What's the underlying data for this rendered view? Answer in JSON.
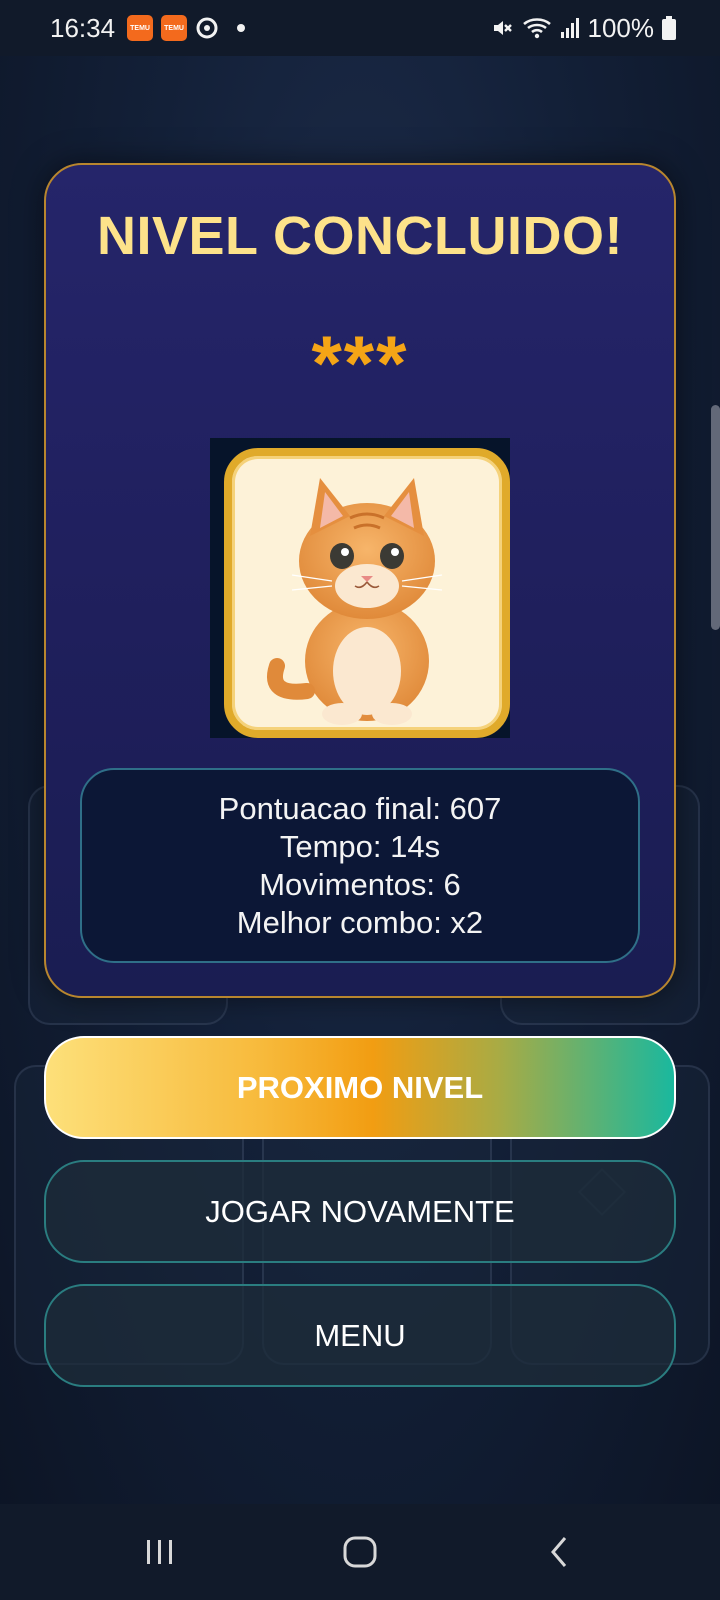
{
  "status_bar": {
    "time": "16:34",
    "battery": "100%",
    "notification_apps": [
      "Temu",
      "Temu"
    ]
  },
  "dialog": {
    "title": "NIVEL CONCLUIDO!",
    "stars": "***",
    "reward_image": "kitten-card"
  },
  "stats": {
    "score": "Pontuacao final: 607",
    "time": "Tempo: 14s",
    "moves": "Movimentos: 6",
    "best_combo": "Melhor combo: x2"
  },
  "buttons": {
    "next_level": "PROXIMO NIVEL",
    "play_again": "JOGAR NOVAMENTE",
    "menu": "MENU"
  },
  "colors": {
    "title": "#fde28a",
    "stars": "#f5a516",
    "dialog_border": "#b8862e",
    "outline_button_border": "#2a7d80"
  },
  "icons": [
    "mute-icon",
    "wifi-icon",
    "signal-icon",
    "battery-icon",
    "recent-apps-icon",
    "home-icon",
    "back-icon"
  ]
}
